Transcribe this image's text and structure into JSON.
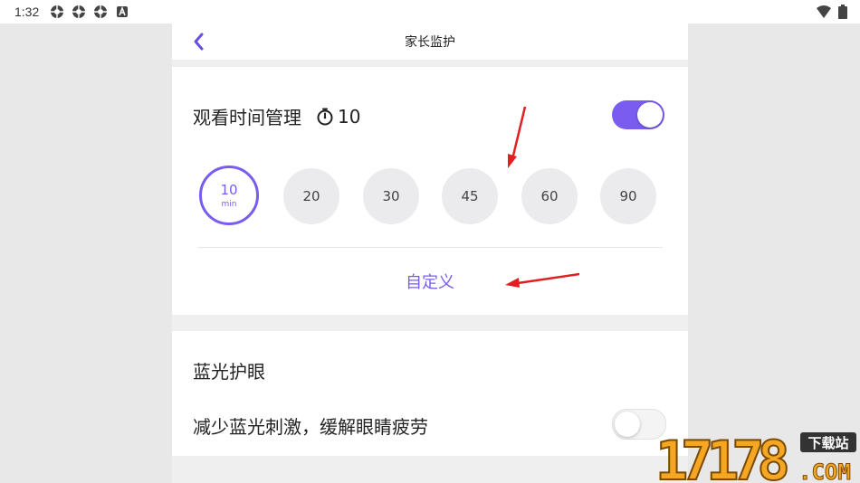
{
  "status_bar": {
    "time": "1:32",
    "left_icons": [
      "sync-icon",
      "sync-icon",
      "sync-icon",
      "a-badge-icon"
    ],
    "right_icons": [
      "wifi-icon",
      "battery-icon"
    ]
  },
  "header": {
    "title": "家长监护",
    "back_icon": "chevron-left-icon"
  },
  "watch_time": {
    "label": "观看时间管理",
    "timer_icon": "timer-icon",
    "timer_value": "10",
    "enabled": true,
    "options": [
      {
        "value": "10",
        "unit": "min",
        "selected": true
      },
      {
        "value": "20"
      },
      {
        "value": "30"
      },
      {
        "value": "45"
      },
      {
        "value": "60"
      },
      {
        "value": "90"
      }
    ],
    "custom_label": "自定义"
  },
  "blue_light": {
    "title": "蓝光护眼",
    "description": "减少蓝光刺激，缓解眼睛疲劳",
    "enabled": false
  },
  "watermark": {
    "number": "17178",
    "tag": "下载站",
    "domain": ".COM"
  },
  "colors": {
    "accent": "#7a5cf0",
    "annotation_arrow": "#e02020",
    "watermark_orange": "#f5a623"
  }
}
